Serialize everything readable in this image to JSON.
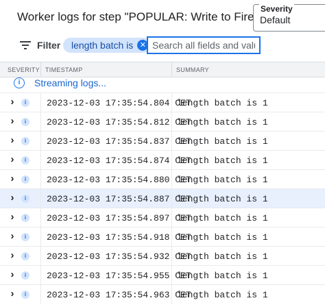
{
  "panel": {
    "title": "Worker logs for step \"POPULAR: Write to Firestore\""
  },
  "severity": {
    "label": "Severity",
    "value": "Default"
  },
  "filter": {
    "label": "Filter",
    "chip_label": "length batch is",
    "search_placeholder": "Search all fields and values"
  },
  "table": {
    "columns": [
      "SEVERITY",
      "TIMESTAMP",
      "SUMMARY"
    ],
    "streaming_text": "Streaming logs...",
    "rows": [
      {
        "severity": "info",
        "timestamp": "2023-12-03 17:35:54.804 CET",
        "summary": "length batch is 1"
      },
      {
        "severity": "info",
        "timestamp": "2023-12-03 17:35:54.812 CET",
        "summary": "length batch is 1"
      },
      {
        "severity": "info",
        "timestamp": "2023-12-03 17:35:54.837 CET",
        "summary": "length batch is 1"
      },
      {
        "severity": "info",
        "timestamp": "2023-12-03 17:35:54.874 CET",
        "summary": "length batch is 1"
      },
      {
        "severity": "info",
        "timestamp": "2023-12-03 17:35:54.880 CET",
        "summary": "length batch is 1"
      },
      {
        "severity": "info",
        "timestamp": "2023-12-03 17:35:54.887 CET",
        "summary": "length batch is 1",
        "hovered": true
      },
      {
        "severity": "info",
        "timestamp": "2023-12-03 17:35:54.897 CET",
        "summary": "length batch is 1"
      },
      {
        "severity": "info",
        "timestamp": "2023-12-03 17:35:54.918 CET",
        "summary": "length batch is 1"
      },
      {
        "severity": "info",
        "timestamp": "2023-12-03 17:35:54.932 CET",
        "summary": "length batch is 1"
      },
      {
        "severity": "info",
        "timestamp": "2023-12-03 17:35:54.955 CET",
        "summary": "length batch is 1"
      },
      {
        "severity": "info",
        "timestamp": "2023-12-03 17:35:54.963 CET",
        "summary": "length batch is 1"
      }
    ]
  },
  "icons": {
    "filter": "filter-icon",
    "chip_close": "close-icon",
    "streaming": "info-icon",
    "expand": "chevron-right-icon",
    "severity_info": "info-icon"
  },
  "colors": {
    "accent": "#1a73e8",
    "chip_bg": "#d2e3fc",
    "hover_row": "#e8f0fe"
  }
}
